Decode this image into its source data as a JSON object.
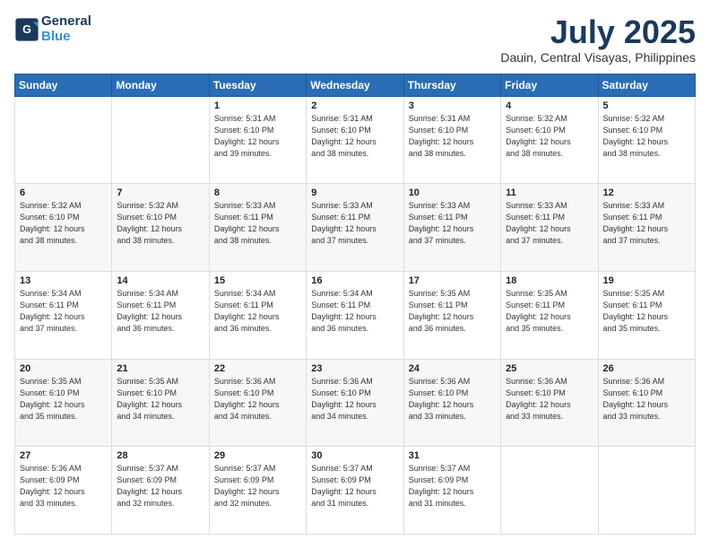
{
  "header": {
    "logo_line1": "General",
    "logo_line2": "Blue",
    "title": "July 2025",
    "subtitle": "Dauin, Central Visayas, Philippines"
  },
  "days_of_week": [
    "Sunday",
    "Monday",
    "Tuesday",
    "Wednesday",
    "Thursday",
    "Friday",
    "Saturday"
  ],
  "weeks": [
    [
      {
        "day": "",
        "info": ""
      },
      {
        "day": "",
        "info": ""
      },
      {
        "day": "1",
        "info": "Sunrise: 5:31 AM\nSunset: 6:10 PM\nDaylight: 12 hours\nand 39 minutes."
      },
      {
        "day": "2",
        "info": "Sunrise: 5:31 AM\nSunset: 6:10 PM\nDaylight: 12 hours\nand 38 minutes."
      },
      {
        "day": "3",
        "info": "Sunrise: 5:31 AM\nSunset: 6:10 PM\nDaylight: 12 hours\nand 38 minutes."
      },
      {
        "day": "4",
        "info": "Sunrise: 5:32 AM\nSunset: 6:10 PM\nDaylight: 12 hours\nand 38 minutes."
      },
      {
        "day": "5",
        "info": "Sunrise: 5:32 AM\nSunset: 6:10 PM\nDaylight: 12 hours\nand 38 minutes."
      }
    ],
    [
      {
        "day": "6",
        "info": "Sunrise: 5:32 AM\nSunset: 6:10 PM\nDaylight: 12 hours\nand 38 minutes."
      },
      {
        "day": "7",
        "info": "Sunrise: 5:32 AM\nSunset: 6:10 PM\nDaylight: 12 hours\nand 38 minutes."
      },
      {
        "day": "8",
        "info": "Sunrise: 5:33 AM\nSunset: 6:11 PM\nDaylight: 12 hours\nand 38 minutes."
      },
      {
        "day": "9",
        "info": "Sunrise: 5:33 AM\nSunset: 6:11 PM\nDaylight: 12 hours\nand 37 minutes."
      },
      {
        "day": "10",
        "info": "Sunrise: 5:33 AM\nSunset: 6:11 PM\nDaylight: 12 hours\nand 37 minutes."
      },
      {
        "day": "11",
        "info": "Sunrise: 5:33 AM\nSunset: 6:11 PM\nDaylight: 12 hours\nand 37 minutes."
      },
      {
        "day": "12",
        "info": "Sunrise: 5:33 AM\nSunset: 6:11 PM\nDaylight: 12 hours\nand 37 minutes."
      }
    ],
    [
      {
        "day": "13",
        "info": "Sunrise: 5:34 AM\nSunset: 6:11 PM\nDaylight: 12 hours\nand 37 minutes."
      },
      {
        "day": "14",
        "info": "Sunrise: 5:34 AM\nSunset: 6:11 PM\nDaylight: 12 hours\nand 36 minutes."
      },
      {
        "day": "15",
        "info": "Sunrise: 5:34 AM\nSunset: 6:11 PM\nDaylight: 12 hours\nand 36 minutes."
      },
      {
        "day": "16",
        "info": "Sunrise: 5:34 AM\nSunset: 6:11 PM\nDaylight: 12 hours\nand 36 minutes."
      },
      {
        "day": "17",
        "info": "Sunrise: 5:35 AM\nSunset: 6:11 PM\nDaylight: 12 hours\nand 36 minutes."
      },
      {
        "day": "18",
        "info": "Sunrise: 5:35 AM\nSunset: 6:11 PM\nDaylight: 12 hours\nand 35 minutes."
      },
      {
        "day": "19",
        "info": "Sunrise: 5:35 AM\nSunset: 6:11 PM\nDaylight: 12 hours\nand 35 minutes."
      }
    ],
    [
      {
        "day": "20",
        "info": "Sunrise: 5:35 AM\nSunset: 6:10 PM\nDaylight: 12 hours\nand 35 minutes."
      },
      {
        "day": "21",
        "info": "Sunrise: 5:35 AM\nSunset: 6:10 PM\nDaylight: 12 hours\nand 34 minutes."
      },
      {
        "day": "22",
        "info": "Sunrise: 5:36 AM\nSunset: 6:10 PM\nDaylight: 12 hours\nand 34 minutes."
      },
      {
        "day": "23",
        "info": "Sunrise: 5:36 AM\nSunset: 6:10 PM\nDaylight: 12 hours\nand 34 minutes."
      },
      {
        "day": "24",
        "info": "Sunrise: 5:36 AM\nSunset: 6:10 PM\nDaylight: 12 hours\nand 33 minutes."
      },
      {
        "day": "25",
        "info": "Sunrise: 5:36 AM\nSunset: 6:10 PM\nDaylight: 12 hours\nand 33 minutes."
      },
      {
        "day": "26",
        "info": "Sunrise: 5:36 AM\nSunset: 6:10 PM\nDaylight: 12 hours\nand 33 minutes."
      }
    ],
    [
      {
        "day": "27",
        "info": "Sunrise: 5:36 AM\nSunset: 6:09 PM\nDaylight: 12 hours\nand 33 minutes."
      },
      {
        "day": "28",
        "info": "Sunrise: 5:37 AM\nSunset: 6:09 PM\nDaylight: 12 hours\nand 32 minutes."
      },
      {
        "day": "29",
        "info": "Sunrise: 5:37 AM\nSunset: 6:09 PM\nDaylight: 12 hours\nand 32 minutes."
      },
      {
        "day": "30",
        "info": "Sunrise: 5:37 AM\nSunset: 6:09 PM\nDaylight: 12 hours\nand 31 minutes."
      },
      {
        "day": "31",
        "info": "Sunrise: 5:37 AM\nSunset: 6:09 PM\nDaylight: 12 hours\nand 31 minutes."
      },
      {
        "day": "",
        "info": ""
      },
      {
        "day": "",
        "info": ""
      }
    ]
  ]
}
